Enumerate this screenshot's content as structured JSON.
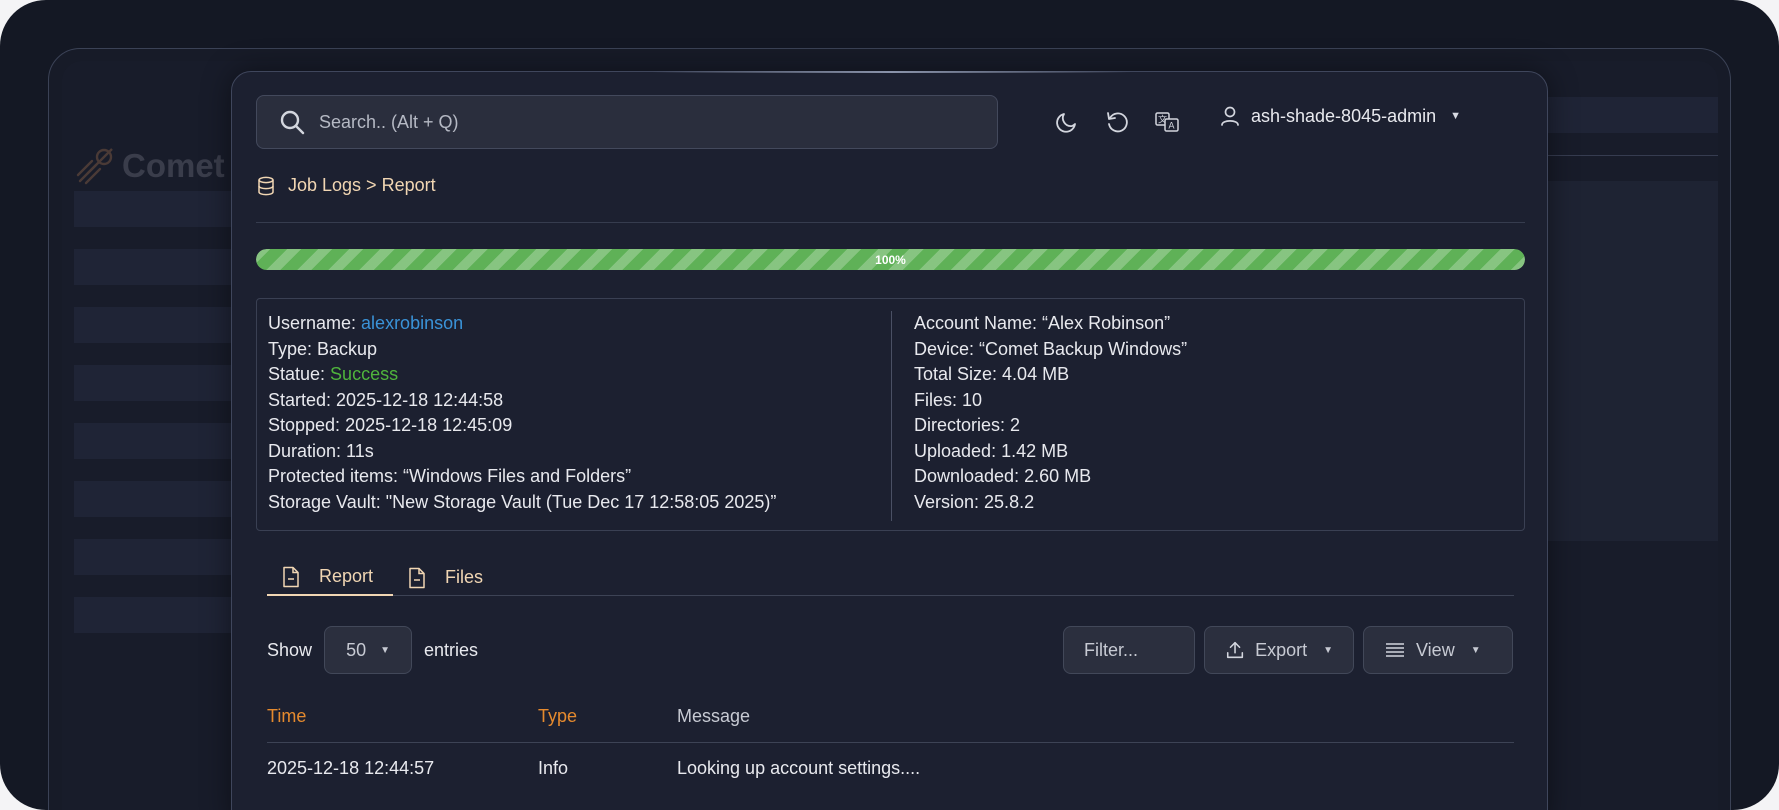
{
  "background": {
    "logo_text": "Comet I"
  },
  "search": {
    "placeholder": "Search.. (Alt + Q)"
  },
  "header": {
    "icons": [
      "moon-icon",
      "refresh-icon",
      "translate-icon"
    ],
    "username": "ash-shade-8045-admin"
  },
  "breadcrumb": {
    "text": "Job Logs > Report"
  },
  "progress": {
    "value_percent": 100,
    "label": "100%",
    "color": "#5fb157"
  },
  "job": {
    "left": {
      "username_label": "Username: ",
      "username_value": "alexrobinson",
      "type": "Type: Backup",
      "status_label": "Statue: ",
      "status_value": "Success",
      "started": "Started: 2025-12-18 12:44:58",
      "stopped": "Stopped: 2025-12-18 12:45:09",
      "duration": "Duration: 11s",
      "protected_items": "Protected items: “Windows Files and Folders”",
      "storage_vault": "Storage Vault: \"New Storage Vault (Tue Dec 17 12:58:05 2025)”"
    },
    "right": {
      "account_name": "Account Name: “Alex Robinson”",
      "device": "Device: “Comet Backup Windows”",
      "total_size": "Total Size: 4.04 MB",
      "files": "Files: 10",
      "directories": "Directories: 2",
      "uploaded": "Uploaded: 1.42 MB",
      "downloaded": "Downloaded: 2.60 MB",
      "version": "Version: 25.8.2"
    }
  },
  "tabs": [
    {
      "label": "Report",
      "active": true
    },
    {
      "label": "Files",
      "active": false
    }
  ],
  "controls": {
    "show_label": "Show",
    "entries_value": "50",
    "entries_label": "entries",
    "filter_placeholder": "Filter...",
    "export_label": "Export",
    "view_label": "View"
  },
  "table": {
    "columns": [
      "Time",
      "Type",
      "Message"
    ],
    "header_colors": [
      "#e58a2e",
      "#e58a2e",
      "#c7cad3"
    ],
    "rows": [
      {
        "time": "2025-12-18 12:44:57",
        "type": "Info",
        "message": "Looking up account settings...."
      }
    ]
  },
  "colors": {
    "accent": "#f1d6b3",
    "link": "#3a93d8",
    "success": "#4fb43c"
  }
}
